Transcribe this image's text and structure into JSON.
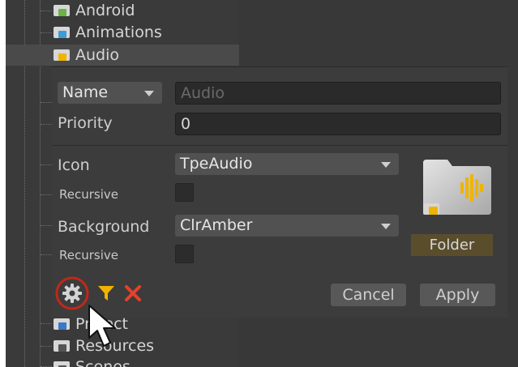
{
  "tree": {
    "items": [
      {
        "label": "Android",
        "icon": "android-folder-icon"
      },
      {
        "label": "Animations",
        "icon": "animations-folder-icon"
      },
      {
        "label": "Audio",
        "icon": "audio-folder-icon",
        "selected": true
      },
      {
        "label": "Project",
        "icon": "project-folder-icon"
      },
      {
        "label": "Resources",
        "icon": "resources-folder-icon"
      },
      {
        "label": "Scenes",
        "icon": "scenes-folder-icon"
      }
    ]
  },
  "editor": {
    "name_dropdown": "Name",
    "name_value": "Audio",
    "priority_label": "Priority",
    "priority_value": "0",
    "icon_label": "Icon",
    "icon_value": "TpeAudio",
    "recursive_label": "Recursive",
    "background_label": "Background",
    "background_value": "ClrAmber",
    "preview_label": "Folder",
    "cancel_label": "Cancel",
    "apply_label": "Apply"
  },
  "colors": {
    "accent_amber": "#f0b400",
    "highlight_ring": "#c0281a",
    "delete_red": "#e8402a"
  }
}
